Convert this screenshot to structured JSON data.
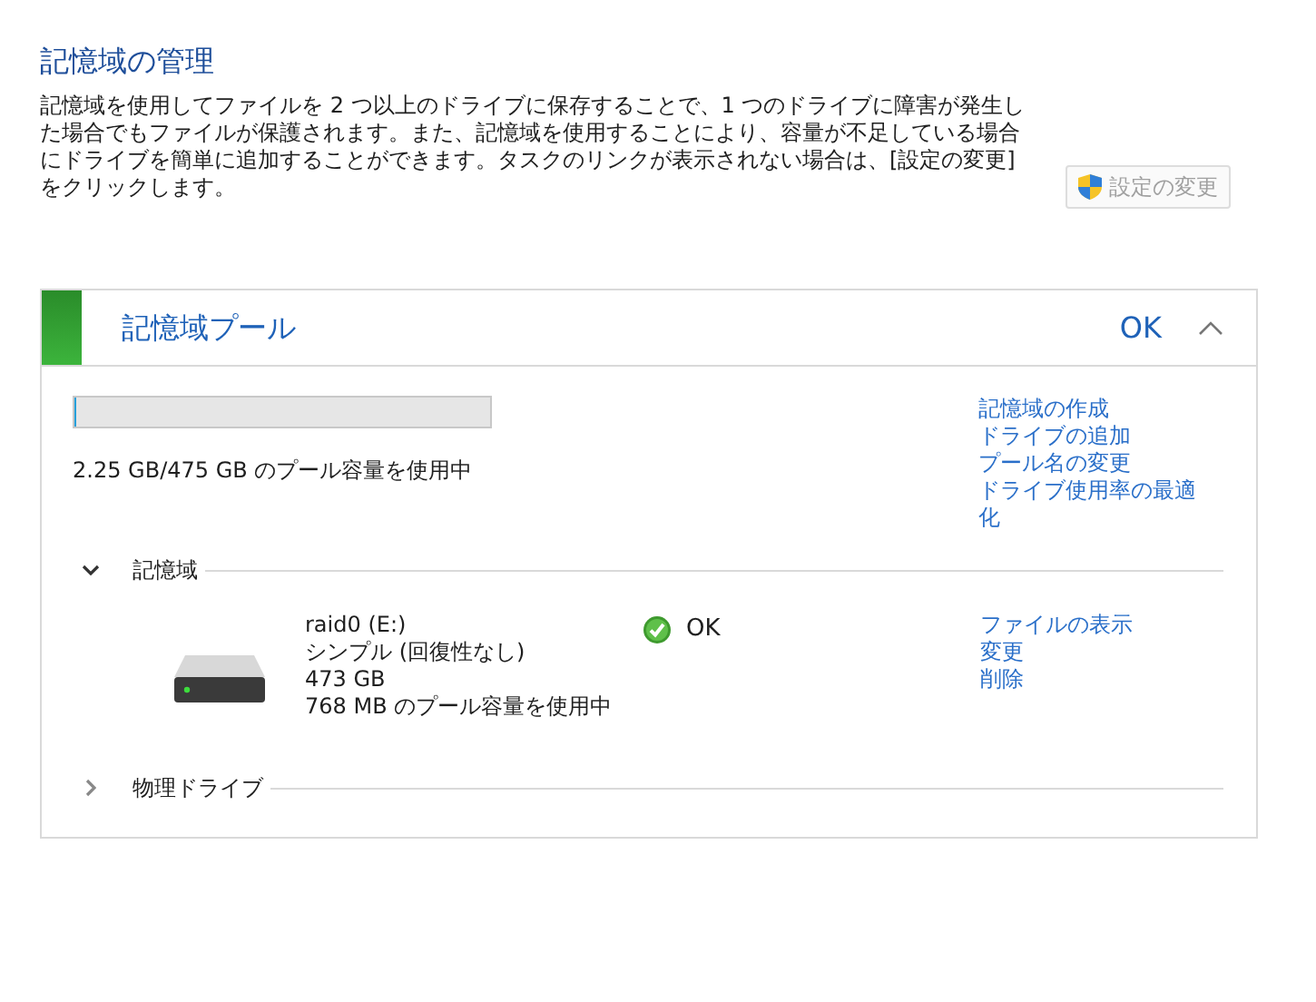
{
  "title": "記憶域の管理",
  "description": "記憶域を使用してファイルを 2 つ以上のドライブに保存することで、1 つのドライブに障害が発生した場合でもファイルが保護されます。また、記憶域を使用することにより、容量が不足している場合にドライブを簡単に追加することができます。タスクのリンクが表示されない場合は、[設定の変更] をクリックします。",
  "settings_button": {
    "label": "設定の変更",
    "disabled": true
  },
  "pool": {
    "name": "記憶域プール",
    "status": "OK",
    "expanded": true,
    "level": 0.005,
    "usage": "2.25 GB/475 GB のプール容量を使用中",
    "tasks": [
      "記憶域の作成",
      "ドライブの追加",
      "プール名の変更",
      "ドライブ使用率の最適化"
    ],
    "sections": [
      {
        "label": "記憶域",
        "expanded": true,
        "spaces": [
          {
            "name": "raid0 (E:)",
            "type": "シンプル (回復性なし)",
            "size": "473 GB",
            "usage": "768 MB のプール容量を使用中",
            "status": "OK",
            "links": [
              "ファイルの表示",
              "変更",
              "削除"
            ]
          }
        ]
      },
      {
        "label": "物理ドライブ",
        "expanded": false
      }
    ]
  }
}
